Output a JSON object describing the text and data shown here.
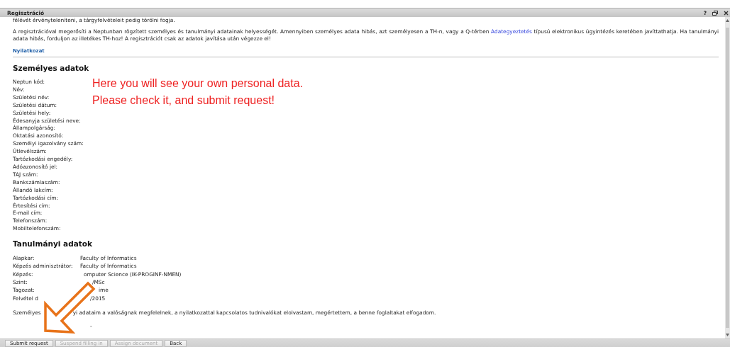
{
  "window": {
    "title": "Regisztráció",
    "help": "?"
  },
  "intro": {
    "clipped_line": "félévét érvényteleníteni, a tárgyfelvételeit pedig törölni fogja.",
    "before_link": "A regisztrációval megerősíti a Neptunban rögzített személyes és tanulmányi adatainak helyességét. Amennyiben személyes adata hibás, azt személyesen a TH-n, vagy a Q-térben ",
    "link": "Adategyeztetés",
    "after_link": " típusú elektronikus ügyintézés keretében javíttathatja. Ha tanulmányi adata hibás, forduljon az illetékes TH-hoz! A regisztrációt csak az adatok javítása után végezze el!"
  },
  "declaration_link": "Nyilatkozat",
  "personal": {
    "heading": "Személyes adatok",
    "fields": [
      "Neptun kód:",
      "Név:",
      "Születési név:",
      "Születési dátum:",
      "Születési hely:",
      "Édesanyja születési neve:",
      "Állampolgárság:",
      "Oktatási azonosító:",
      "Személyi igazolvány szám:",
      "Útlevélszám:",
      "Tartózkodási engedély:",
      "Adóazonosító jel:",
      "TAJ szám:",
      "Bankszámlaszám:",
      "Állandó lakcím:",
      "Tartózkodási cím:",
      "Értesítési cím:",
      "E-mail cím:",
      "Telefonszám:",
      "Mobiltelefonszám:"
    ]
  },
  "note": [
    "Here you will see your own personal data.",
    "Please check it, and submit request!"
  ],
  "study": {
    "heading": "Tanulmányi adatok",
    "rows": [
      {
        "label": "Alapkar:",
        "value": "Faculty of Informatics"
      },
      {
        "label": "Képzés adminisztrátor:",
        "value": "Faculty of Informatics"
      },
      {
        "label": "Képzés:",
        "value": "omputer Science (IK-PROGINF-NMEN)"
      },
      {
        "label": "Szint:",
        "value": "/MSc"
      },
      {
        "label": "Tagozat:",
        "value": "ime"
      },
      {
        "label": "Felvétel d",
        "value": "/2015"
      }
    ]
  },
  "statement": {
    "start": "Személyes",
    "end": "yi adataim a valóságnak megfelelnek, a nyilatkozattal kapcsolatos tudnivalókat elolvastam, megértettem, a benne foglaltakat elfogadom."
  },
  "dash": "-",
  "buttons": [
    {
      "label": "Submit request",
      "disabled": false
    },
    {
      "label": "Suspend filling in",
      "disabled": true
    },
    {
      "label": "Assign document",
      "disabled": true
    },
    {
      "label": "Back",
      "disabled": false
    }
  ]
}
